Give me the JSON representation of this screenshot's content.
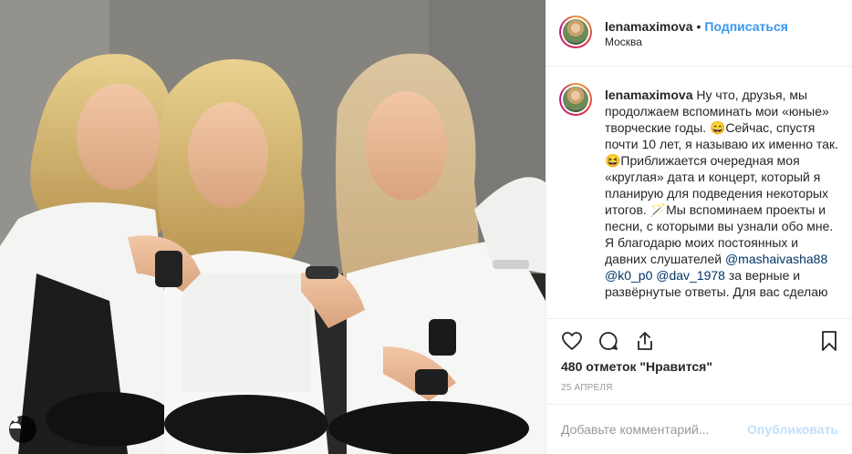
{
  "post": {
    "username": "lenamaximova",
    "separator": "•",
    "follow_label": "Подписаться",
    "location": "Москва"
  },
  "caption": {
    "username": "lenamaximova",
    "part1": " Ну что, друзья, мы продолжаем вспоминать мои «юные» творческие годы. 😄Сейчас, спустя почти 10 лет, я называю их именно так. 😆Приближается очередная моя «круглая» дата и концерт, который я планирую для подведения некоторых итогов. 🪄Мы вспоминаем проекты и песни, с которыми вы узнали обо мне. Я благодарю моих постоянных и давних слушателей ",
    "mention1": "@mashaivasha88",
    "space1": " ",
    "mention2": "@k0_p0",
    "space2": " ",
    "mention3": "@dav_1978",
    "part2": " за верные и развёрнутые ответы. Для вас сделаю"
  },
  "likes": {
    "count": "480",
    "text": " отметок ",
    "label": "\"Нравится\""
  },
  "date": "25 апреля",
  "comment": {
    "placeholder": "Добавьте комментарий...",
    "publish_label": "Опубликовать"
  },
  "icons": {
    "like": "heart-icon",
    "comment": "comment-bubble-icon",
    "share": "share-icon",
    "save": "bookmark-icon",
    "user_tags": "person-icon"
  },
  "colors": {
    "accent": "#3897f0",
    "mention": "#003569",
    "muted": "#999999",
    "border": "#efefef"
  }
}
